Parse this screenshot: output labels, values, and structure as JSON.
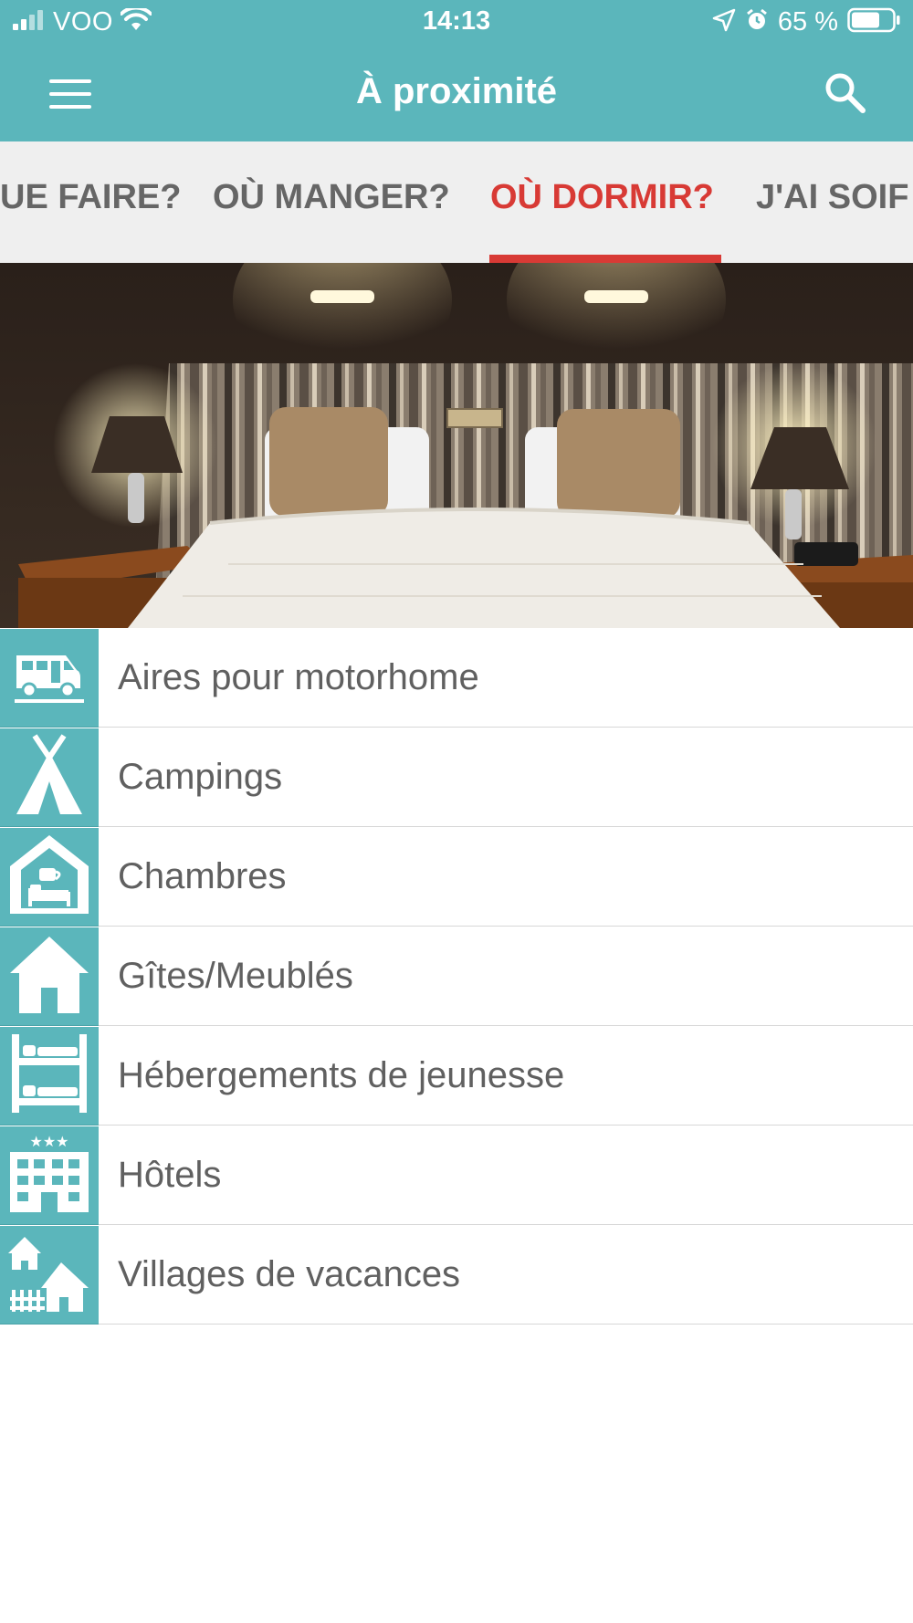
{
  "status_bar": {
    "carrier": "VOO",
    "time": "14:13",
    "battery": "65 %"
  },
  "app_bar": {
    "title": "À proximité",
    "menu_icon": "hamburger-menu-icon",
    "search_icon": "search-icon"
  },
  "tabs": [
    {
      "label": "UE FAIRE?",
      "active": false
    },
    {
      "label": "OÙ MANGER?",
      "active": false
    },
    {
      "label": "OÙ DORMIR?",
      "active": true
    },
    {
      "label": "J'AI SOIF",
      "active": false
    }
  ],
  "colors": {
    "brand": "#5bb6bb",
    "accent": "#d83a35",
    "text": "#606060"
  },
  "hero": {
    "subject": "hotel-bedroom-photo"
  },
  "categories": [
    {
      "label": "Aires pour motorhome",
      "icon": "motorhome-icon"
    },
    {
      "label": "Campings",
      "icon": "tent-icon"
    },
    {
      "label": "Chambres",
      "icon": "guest-room-icon"
    },
    {
      "label": "Gîtes/Meublés",
      "icon": "house-icon"
    },
    {
      "label": "Hébergements de jeunesse",
      "icon": "bunk-bed-icon"
    },
    {
      "label": "Hôtels",
      "icon": "hotel-icon"
    },
    {
      "label": "Villages de vacances",
      "icon": "holiday-village-icon"
    }
  ]
}
